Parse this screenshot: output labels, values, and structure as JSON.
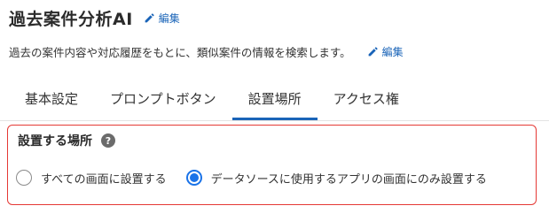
{
  "header": {
    "title": "過去案件分析AI",
    "title_edit_label": "編集"
  },
  "description": {
    "text": "過去の案件内容や対応履歴をもとに、類似案件の情報を検索します。",
    "edit_label": "編集"
  },
  "tabs": [
    {
      "label": "基本設定",
      "active": false
    },
    {
      "label": "プロンプトボタン",
      "active": false
    },
    {
      "label": "設置場所",
      "active": true
    },
    {
      "label": "アクセス権",
      "active": false
    }
  ],
  "location_section": {
    "title": "設置する場所",
    "help_icon": "?",
    "options": [
      {
        "label": "すべての画面に設置する",
        "selected": false
      },
      {
        "label": "データソースに使用するアプリの画面にのみ設置する",
        "selected": true
      }
    ]
  },
  "colors": {
    "accent": "#1a64b8",
    "radio_selected": "#1a73e8",
    "highlight_border": "#e53935"
  },
  "icons": {
    "edit": "pencil-icon",
    "help": "question-circle-icon"
  }
}
